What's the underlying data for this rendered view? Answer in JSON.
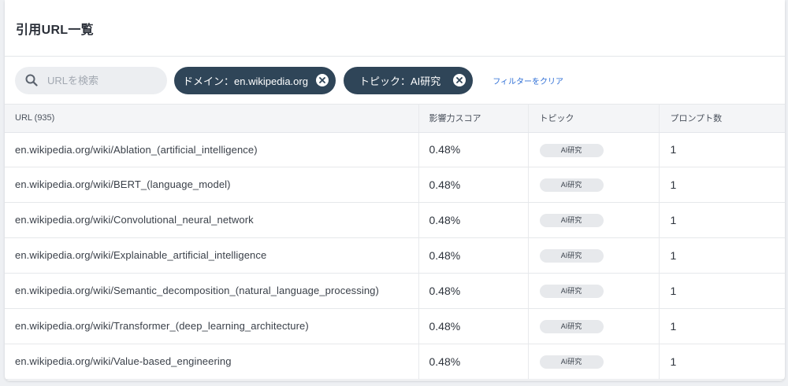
{
  "header": {
    "title": "引用URL一覧"
  },
  "filters": {
    "search_placeholder": "URLを検索",
    "chips": [
      {
        "label": "ドメイン：en.wikipedia.org"
      },
      {
        "label": "トピック：AI研究"
      }
    ],
    "clear_label": "フィルターをクリア"
  },
  "table": {
    "columns": {
      "url": "URL (935)",
      "score": "影響力スコア",
      "topic": "トピック",
      "prompts": "プロンプト数"
    },
    "rows": [
      {
        "url": "en.wikipedia.org/wiki/Ablation_(artificial_intelligence)",
        "score": "0.48%",
        "topic": "AI研究",
        "prompts": "1"
      },
      {
        "url": "en.wikipedia.org/wiki/BERT_(language_model)",
        "score": "0.48%",
        "topic": "AI研究",
        "prompts": "1"
      },
      {
        "url": "en.wikipedia.org/wiki/Convolutional_neural_network",
        "score": "0.48%",
        "topic": "AI研究",
        "prompts": "1"
      },
      {
        "url": "en.wikipedia.org/wiki/Explainable_artificial_intelligence",
        "score": "0.48%",
        "topic": "AI研究",
        "prompts": "1"
      },
      {
        "url": "en.wikipedia.org/wiki/Semantic_decomposition_(natural_language_processing)",
        "score": "0.48%",
        "topic": "AI研究",
        "prompts": "1"
      },
      {
        "url": "en.wikipedia.org/wiki/Transformer_(deep_learning_architecture)",
        "score": "0.48%",
        "topic": "AI研究",
        "prompts": "1"
      },
      {
        "url": "en.wikipedia.org/wiki/Value-based_engineering",
        "score": "0.48%",
        "topic": "AI研究",
        "prompts": "1"
      }
    ]
  }
}
